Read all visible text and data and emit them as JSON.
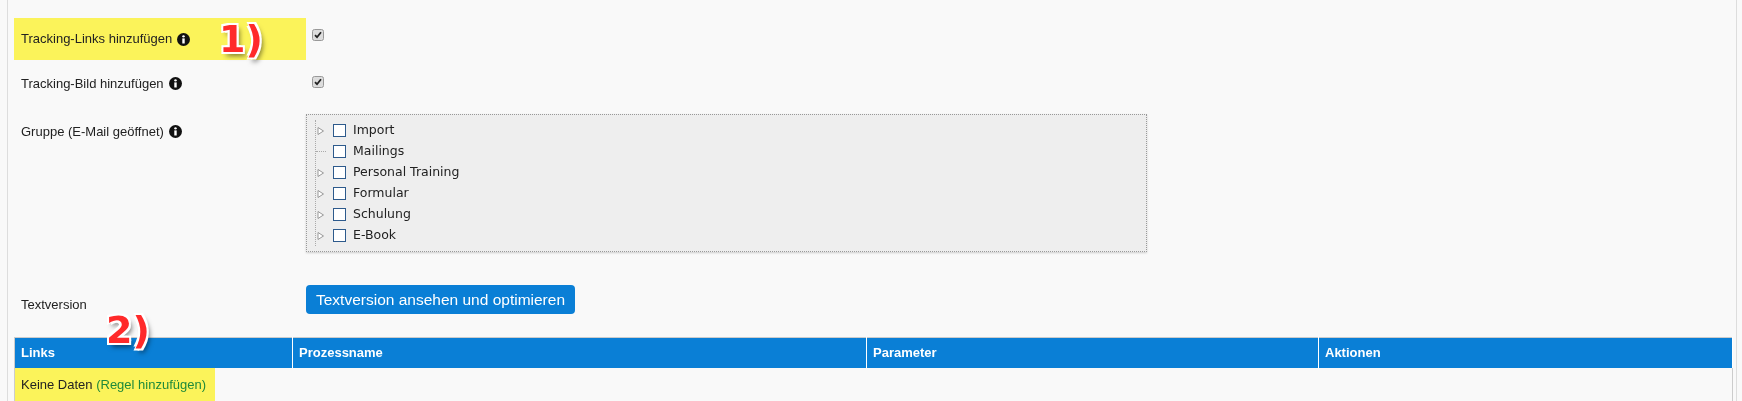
{
  "settings": [
    {
      "label": "Tracking-Links hinzufügen",
      "info": true,
      "highlighted": true,
      "annotation": "1)",
      "kind": "checkbox",
      "checked": true
    },
    {
      "label": "Tracking-Bild hinzufügen",
      "info": true,
      "highlighted": false,
      "kind": "checkbox",
      "checked": true
    },
    {
      "label": "Gruppe (E-Mail geöffnet)",
      "info": true,
      "highlighted": false,
      "kind": "tree",
      "tree": [
        {
          "label": "Import",
          "expandable": true,
          "checked": false
        },
        {
          "label": "Mailings",
          "expandable": false,
          "checked": false
        },
        {
          "label": "Personal Training",
          "expandable": true,
          "checked": false
        },
        {
          "label": "Formular",
          "expandable": true,
          "checked": false
        },
        {
          "label": "Schulung",
          "expandable": true,
          "checked": false
        },
        {
          "label": "E-Book",
          "expandable": true,
          "checked": false
        }
      ]
    },
    {
      "label": "Textversion",
      "info": false,
      "highlighted": false,
      "kind": "button",
      "button": "Textversion ansehen und optimieren"
    }
  ],
  "table": {
    "columns": [
      "Links",
      "Prozessname",
      "Parameter",
      "Aktionen"
    ],
    "empty_text": "Keine Daten",
    "empty_link": "(Regel hinzufügen)",
    "highlighted": true,
    "annotation": "2)"
  }
}
